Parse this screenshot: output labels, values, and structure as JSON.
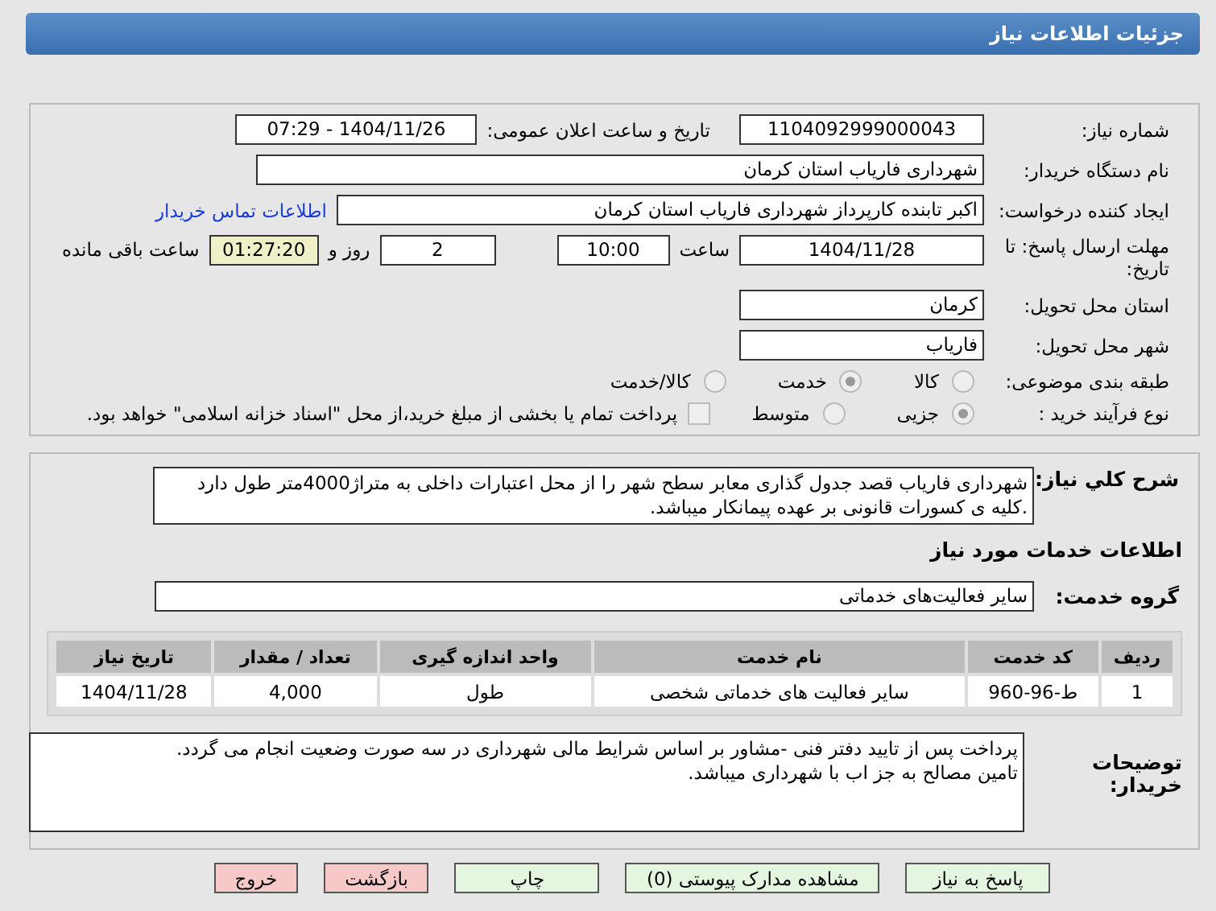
{
  "header": {
    "title": "جزئیات اطلاعات نیاز"
  },
  "need_number": {
    "label": "شماره نیاز:",
    "value": "1104092999000043"
  },
  "announce": {
    "label": "تاریخ و ساعت اعلان عمومی:",
    "value": "1404/11/26 - 07:29"
  },
  "buyer": {
    "label": "نام دستگاه خریدار:",
    "value": "شهرداری فاریاب استان کرمان"
  },
  "creator": {
    "label": "ایجاد کننده درخواست:",
    "value": "اکبر تابنده کارپرداز شهرداری فاریاب استان کرمان",
    "link": "اطلاعات تماس خریدار"
  },
  "deadline": {
    "label": "مهلت ارسال پاسخ: تا تاریخ:",
    "date": "1404/11/28",
    "time_label": "ساعت",
    "time": "10:00",
    "days": "2",
    "days_label": "روز و",
    "remaining": "01:27:20",
    "remaining_label": "ساعت باقی مانده"
  },
  "province": {
    "label": "استان محل تحویل:",
    "value": "کرمان"
  },
  "city": {
    "label": "شهر محل تحویل:",
    "value": "فاریاب"
  },
  "category": {
    "label": "طبقه بندی موضوعی:",
    "options": [
      {
        "label": "کالا",
        "selected": false
      },
      {
        "label": "خدمت",
        "selected": true
      },
      {
        "label": "کالا/خدمت",
        "selected": false
      }
    ]
  },
  "purchase_type": {
    "label": "نوع فرآیند خرید :",
    "options": [
      {
        "label": "جزیی",
        "selected": true
      },
      {
        "label": "متوسط",
        "selected": false
      }
    ],
    "checkbox": {
      "label": "پرداخت تمام یا بخشی از مبلغ خرید،از محل \"اسناد خزانه اسلامی\" خواهد بود.",
      "checked": false
    }
  },
  "description": {
    "label": "شرح کلي نياز:",
    "value": "شهرداری فاریاب قصد جدول گذاری معابر سطح شهر را از محل اعتبارات داخلی به متراژ4000متر طول دارد .کلیه ی کسورات قانونی بر عهده پیمانکار میباشد."
  },
  "services_title": "اطلاعات خدمات مورد نیاز",
  "service_group": {
    "label": "گروه خدمت:",
    "value": "سایر فعالیت‌های خدماتی"
  },
  "table": {
    "columns": [
      "ردیف",
      "کد خدمت",
      "نام خدمت",
      "واحد اندازه گیری",
      "تعداد / مقدار",
      "تاریخ نیاز"
    ],
    "rows": [
      [
        "1",
        "ط-96-960",
        "سایر فعالیت های خدماتی شخصی",
        "طول",
        "4,000",
        "1404/11/28"
      ]
    ]
  },
  "buyer_notes": {
    "label": "توضیحات خریدار:",
    "lines": [
      "پرداخت پس از تایید دفتر فنی -مشاور بر اساس شرایط مالی شهرداری در سه صورت وضعیت انجام می گردد.",
      "تامین مصالح به جز اب با شهرداری میباشد."
    ]
  },
  "buttons": [
    {
      "label": "پاسخ به نیاز",
      "kind": "green"
    },
    {
      "label": "مشاهده مدارک پیوستی (0)",
      "kind": "green"
    },
    {
      "label": "چاپ",
      "kind": "green"
    },
    {
      "label": "بازگشت",
      "kind": "red"
    },
    {
      "label": "خروج",
      "kind": "red"
    }
  ]
}
